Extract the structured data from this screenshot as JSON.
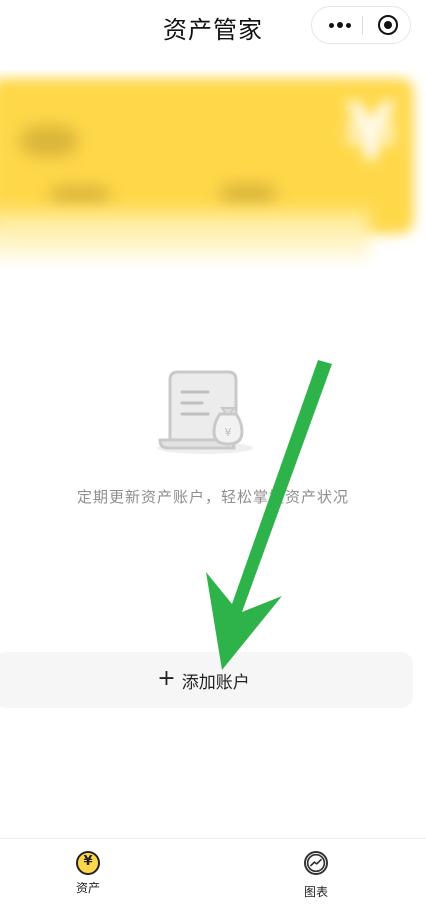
{
  "header": {
    "title": "资产管家"
  },
  "empty_state": {
    "message": "定期更新资产账户，轻松掌握资产状况"
  },
  "actions": {
    "add_account_label": "添加账户"
  },
  "tabbar": {
    "items": [
      {
        "label": "资产",
        "icon": "yen-icon",
        "active": true
      },
      {
        "label": "图表",
        "icon": "trend-chart-icon",
        "active": false
      }
    ]
  },
  "colors": {
    "accent": "#ffd84a",
    "arrow": "#2db34a",
    "button_bg": "#f6f6f7",
    "muted_text": "#8e8e8e"
  }
}
